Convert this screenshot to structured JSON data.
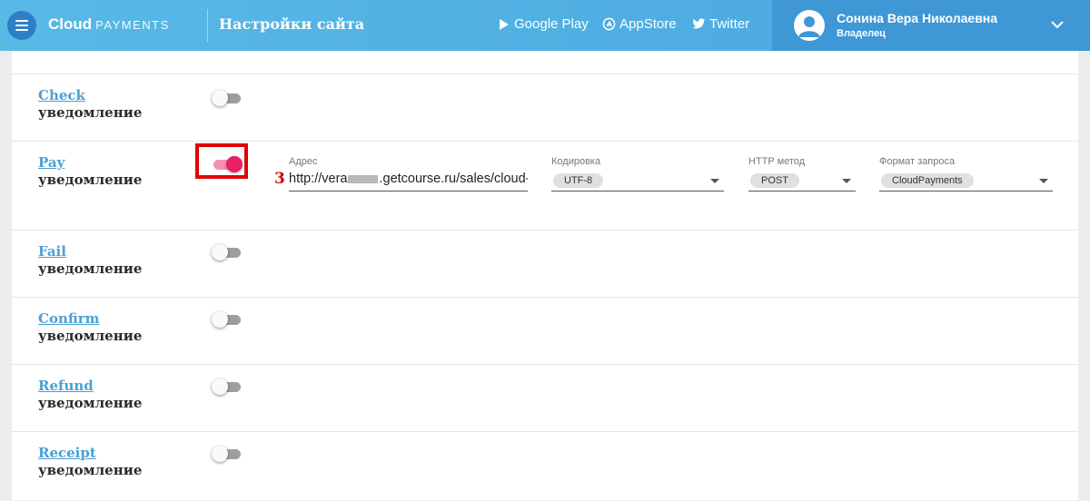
{
  "header": {
    "logo_bold": "Cloud",
    "logo_light": "PAYMENTS",
    "page_title": "Настройки сайта",
    "links": [
      {
        "label": "Google Play",
        "icon": "play-icon"
      },
      {
        "label": "AppStore",
        "icon": "appstore-icon"
      },
      {
        "label": "Twitter",
        "icon": "twitter-icon"
      }
    ],
    "user": {
      "name": "Сонина Вера Николаевна",
      "role": "Владелец"
    }
  },
  "notifications": [
    {
      "name": "Check",
      "sub": "уведомление",
      "enabled": false
    },
    {
      "name": "Pay",
      "sub": "уведомление",
      "enabled": true
    },
    {
      "name": "Fail",
      "sub": "уведомление",
      "enabled": false
    },
    {
      "name": "Confirm",
      "sub": "уведомление",
      "enabled": false
    },
    {
      "name": "Refund",
      "sub": "уведомление",
      "enabled": false
    },
    {
      "name": "Receipt",
      "sub": "уведомление",
      "enabled": false
    }
  ],
  "pay_settings": {
    "address_label": "Адрес",
    "address_prefix": "http://vera",
    "address_suffix": ".getcourse.ru/sales/cloud-p",
    "encoding_label": "Кодировка",
    "encoding_value": "UTF-8",
    "method_label": "HTTP метод",
    "method_value": "POST",
    "format_label": "Формат запроса",
    "format_value": "CloudPayments"
  },
  "annotation": {
    "marker": "3",
    "color": "#e00000"
  },
  "colors": {
    "header": "#4aa6df",
    "link": "#4aa0d4",
    "toggle_on": "#e91e63"
  }
}
